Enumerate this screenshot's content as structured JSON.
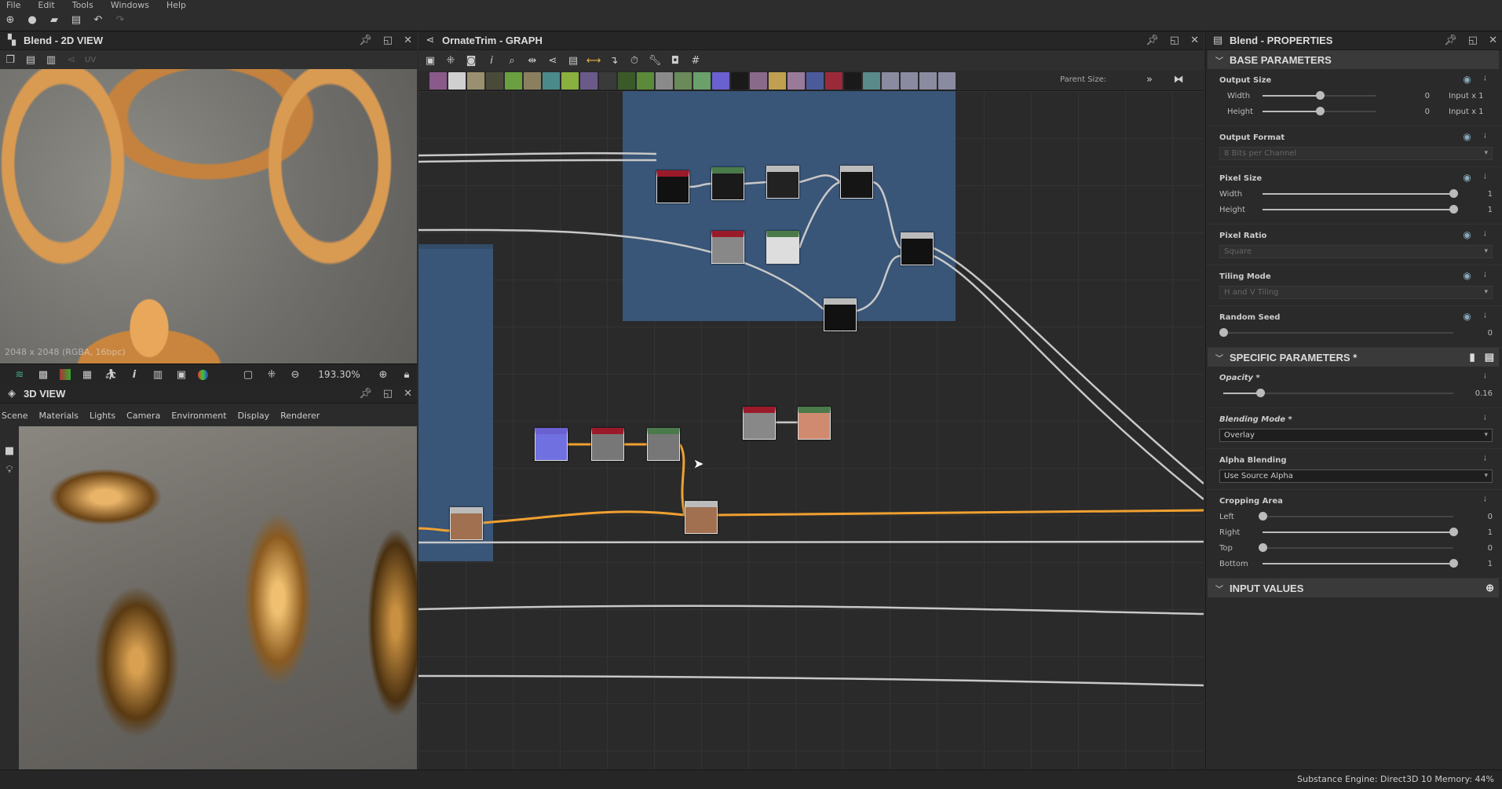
{
  "menu": [
    "File",
    "Edit",
    "Tools",
    "Windows",
    "Help"
  ],
  "view2d": {
    "title": "Blend - 2D VIEW",
    "uv_label": "UV",
    "info": "2048 x 2048 (RGBA, 16bpc)",
    "zoom": "193.30%"
  },
  "view3d": {
    "title": "3D VIEW",
    "menu": [
      "Scene",
      "Materials",
      "Lights",
      "Camera",
      "Environment",
      "Display",
      "Renderer"
    ]
  },
  "graph": {
    "title": "OrnateTrim - GRAPH",
    "parent_size_label": "Parent Size:",
    "wire_highlight": "#f0a030",
    "toolbar_swatches": [
      "#8a5a8a",
      "#d0d0d0",
      "#9a9070",
      "#4a4a3a",
      "#6aa040",
      "#8a8060",
      "#4a8a8a",
      "#8ab040",
      "#6a5a8a",
      "#3a3a3a",
      "#3a5a2a",
      "#5a8a3a",
      "#8a8a8a",
      "#6a8a5a",
      "#6aa06a",
      "#6a60d0",
      "#1a1a1a",
      "#8a6a8a",
      "#c0a050",
      "#9a7a9a",
      "#4a5a9a",
      "#9a2a3a",
      "#1a1a1a",
      "#5a8a8a",
      "#8a8aa0",
      "#8a8aa0",
      "#8a8aa0",
      "#8a8aa0"
    ],
    "nodes": [
      {
        "header": "#9a1a2a",
        "thumb": "#111"
      },
      {
        "header": "#4a7a4a",
        "thumb": "#1a1a1a"
      },
      {
        "header": "#bbbbbb",
        "thumb": "#222"
      },
      {
        "header": "#bbbbbb",
        "thumb": "#151515"
      },
      {
        "header": "#9a1a2a",
        "thumb": "#888"
      },
      {
        "header": "#4a7a4a",
        "thumb": "#ddd"
      },
      {
        "header": "#bbbbbb",
        "thumb": "#111"
      },
      {
        "header": "#bbbbbb",
        "thumb": "#111"
      },
      {
        "header": "#6a60d0",
        "thumb": "#7070e0"
      },
      {
        "header": "#9a1a2a",
        "thumb": "#777"
      },
      {
        "header": "#4a7a4a",
        "thumb": "#777"
      },
      {
        "header": "#9a1a2a",
        "thumb": "#888"
      },
      {
        "header": "#4a7a4a",
        "thumb": "#d08a70"
      },
      {
        "header": "#bbbbbb",
        "thumb": "#a07050"
      },
      {
        "header": "#bbbbbb",
        "thumb": "#a07050"
      }
    ]
  },
  "properties": {
    "title": "Blend - PROPERTIES",
    "base": {
      "title": "BASE PARAMETERS",
      "output_size": {
        "label": "Output Size",
        "width_label": "Width",
        "height_label": "Height",
        "width": "0",
        "height": "0",
        "width_mode": "Input x 1",
        "height_mode": "Input x 1",
        "width_pos": 0.5,
        "height_pos": 0.5
      },
      "output_format": {
        "label": "Output Format",
        "value": "8 Bits per Channel"
      },
      "pixel_size": {
        "label": "Pixel Size",
        "width_label": "Width",
        "height_label": "Height",
        "width": "1",
        "height": "1"
      },
      "pixel_ratio": {
        "label": "Pixel Ratio",
        "value": "Square"
      },
      "tiling_mode": {
        "label": "Tiling Mode",
        "value": "H and V Tiling"
      },
      "random_seed": {
        "label": "Random Seed",
        "value": "0"
      }
    },
    "specific": {
      "title": "SPECIFIC PARAMETERS *",
      "opacity": {
        "label": "Opacity *",
        "value": "0.16"
      },
      "blending_mode": {
        "label": "Blending Mode *",
        "value": "Overlay"
      },
      "alpha_blending": {
        "label": "Alpha Blending",
        "value": "Use Source Alpha"
      },
      "cropping": {
        "label": "Cropping Area",
        "left_label": "Left",
        "right_label": "Right",
        "top_label": "Top",
        "bottom_label": "Bottom",
        "left": "0",
        "right": "1",
        "top": "0",
        "bottom": "1"
      }
    },
    "input_values": {
      "title": "INPUT VALUES"
    }
  },
  "status": {
    "text": "Substance Engine: Direct3D 10  Memory: 44%"
  }
}
